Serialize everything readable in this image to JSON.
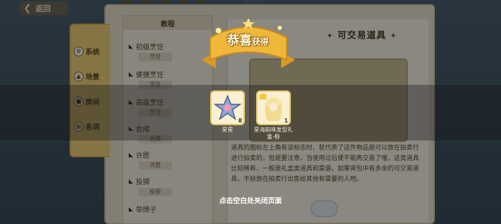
{
  "header": {
    "back_label": "返回"
  },
  "categories": [
    {
      "label": "系统",
      "icon": "gear-icon"
    },
    {
      "label": "场景",
      "icon": "scene-icon"
    },
    {
      "label": "房间",
      "icon": "room-icon"
    },
    {
      "label": "名词",
      "icon": "book-icon"
    }
  ],
  "list": {
    "header": "教程",
    "items": [
      {
        "title": "初级烹饪",
        "sub": "烹饪"
      },
      {
        "title": "便捷烹饪",
        "sub": "烹饪"
      },
      {
        "title": "高级烹饪",
        "sub": "烹饪"
      },
      {
        "title": "合成",
        "sub": "合成"
      },
      {
        "title": "许愿",
        "sub": "许愿"
      },
      {
        "title": "投掷",
        "sub": "投掷"
      },
      {
        "title": "举牌子",
        "sub": ""
      }
    ]
  },
  "content": {
    "title": "可交易道具",
    "description": "道具的图标左上角有该标志时，就代表了这件物品是可以放在拍卖行进行拍卖的，但是要注意，当使用过后便不能再交易了哦，这类道具比较稀有，一般是礼盒类道具和菜谱，如果背包中有多余的可交易道具，不妨放在拍卖行出售给其他有需要的人吧。"
  },
  "popup": {
    "banner_main": "恭喜",
    "banner_sub": "获得",
    "rewards": [
      {
        "name": "星星",
        "count": "8",
        "icon": "star-icon"
      },
      {
        "name": "星海韵味发型礼盒-粉",
        "count": "1",
        "icon": "hair-gift-icon"
      }
    ],
    "close_hint": "点击空白处关闭页面"
  },
  "colors": {
    "accent": "#f4d67c",
    "banner_gold": "#f0b83a",
    "paper": "#efe6d2"
  }
}
